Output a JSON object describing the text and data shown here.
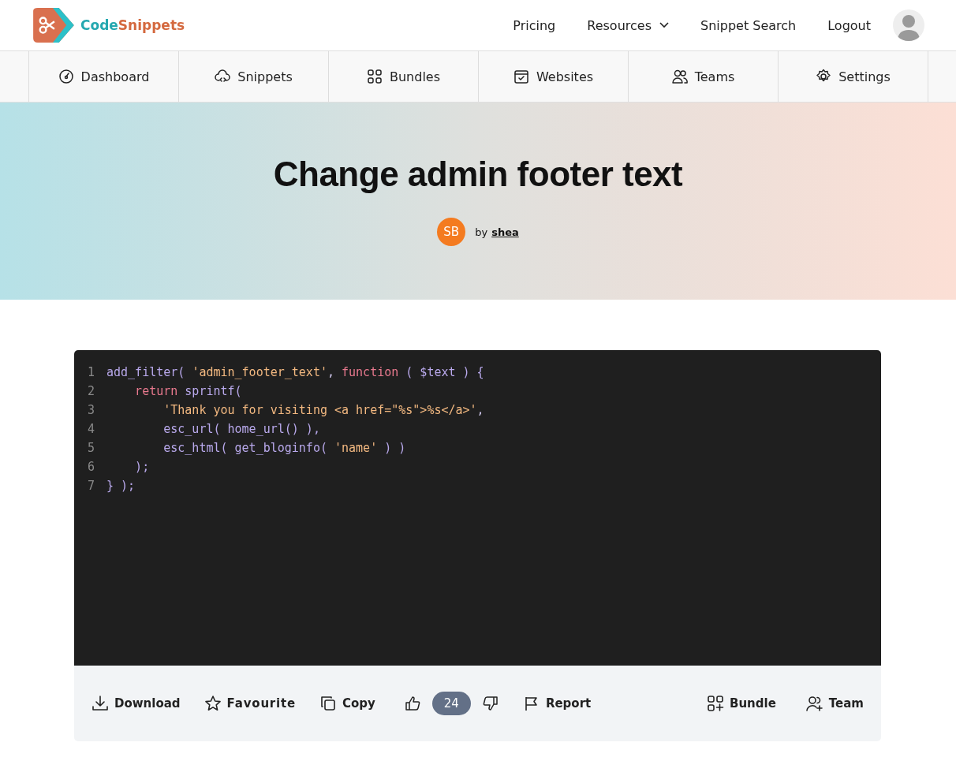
{
  "header": {
    "logo_text_1": "Code",
    "logo_text_2": "Snippets",
    "nav": [
      {
        "label": "Pricing",
        "kind": "link"
      },
      {
        "label": "Resources",
        "kind": "dropdown"
      },
      {
        "label": "Snippet Search",
        "kind": "link"
      },
      {
        "label": "Logout",
        "kind": "link"
      }
    ]
  },
  "tabs": [
    {
      "label": "Dashboard",
      "kind": "dashboard"
    },
    {
      "label": "Snippets",
      "kind": "cloud"
    },
    {
      "label": "Bundles",
      "kind": "grid"
    },
    {
      "label": "Websites",
      "kind": "calendar"
    },
    {
      "label": "Teams",
      "kind": "people"
    },
    {
      "label": "Settings",
      "kind": "gear"
    }
  ],
  "hero": {
    "title": "Change admin footer text",
    "author_initials": "SB",
    "by": "by",
    "author": "shea"
  },
  "code": {
    "lines": [
      {
        "number": "1",
        "tokens": [
          {
            "t": "add_filter( ",
            "kind": "fn"
          },
          {
            "t": "'admin_footer_text'",
            "kind": "str"
          },
          {
            "t": ", ",
            "kind": "punc"
          },
          {
            "t": "function",
            "kind": "kw"
          },
          {
            "t": " ( $text ) {",
            "kind": "fn"
          }
        ]
      },
      {
        "number": "2",
        "tokens": [
          {
            "t": "    return",
            "kind": "kw"
          },
          {
            "t": " sprintf(",
            "kind": "fn"
          }
        ]
      },
      {
        "number": "3",
        "tokens": [
          {
            "t": "        'Thank you for visiting <a href=\"%s\">%s</a>'",
            "kind": "str"
          },
          {
            "t": ",",
            "kind": "punc"
          }
        ]
      },
      {
        "number": "4",
        "tokens": [
          {
            "t": "        esc_url( home_url() ),",
            "kind": "fn"
          }
        ]
      },
      {
        "number": "5",
        "tokens": [
          {
            "t": "        esc_html( get_bloginfo( ",
            "kind": "fn"
          },
          {
            "t": "'name'",
            "kind": "str"
          },
          {
            "t": " ) )",
            "kind": "fn"
          }
        ]
      },
      {
        "number": "6",
        "tokens": [
          {
            "t": "    );",
            "kind": "fn"
          }
        ]
      },
      {
        "number": "7",
        "tokens": [
          {
            "t": "} );",
            "kind": "fn"
          }
        ]
      }
    ]
  },
  "actions_left": [
    {
      "label": "Download",
      "kind": "download"
    },
    {
      "label": "Favourite",
      "kind": "star"
    },
    {
      "label": "Copy",
      "kind": "copy"
    }
  ],
  "votes": {
    "count": "24"
  },
  "report": {
    "label": "Report"
  },
  "actions_right": [
    {
      "label": "Bundle",
      "kind": "bundle"
    },
    {
      "label": "Team",
      "kind": "team"
    }
  ]
}
